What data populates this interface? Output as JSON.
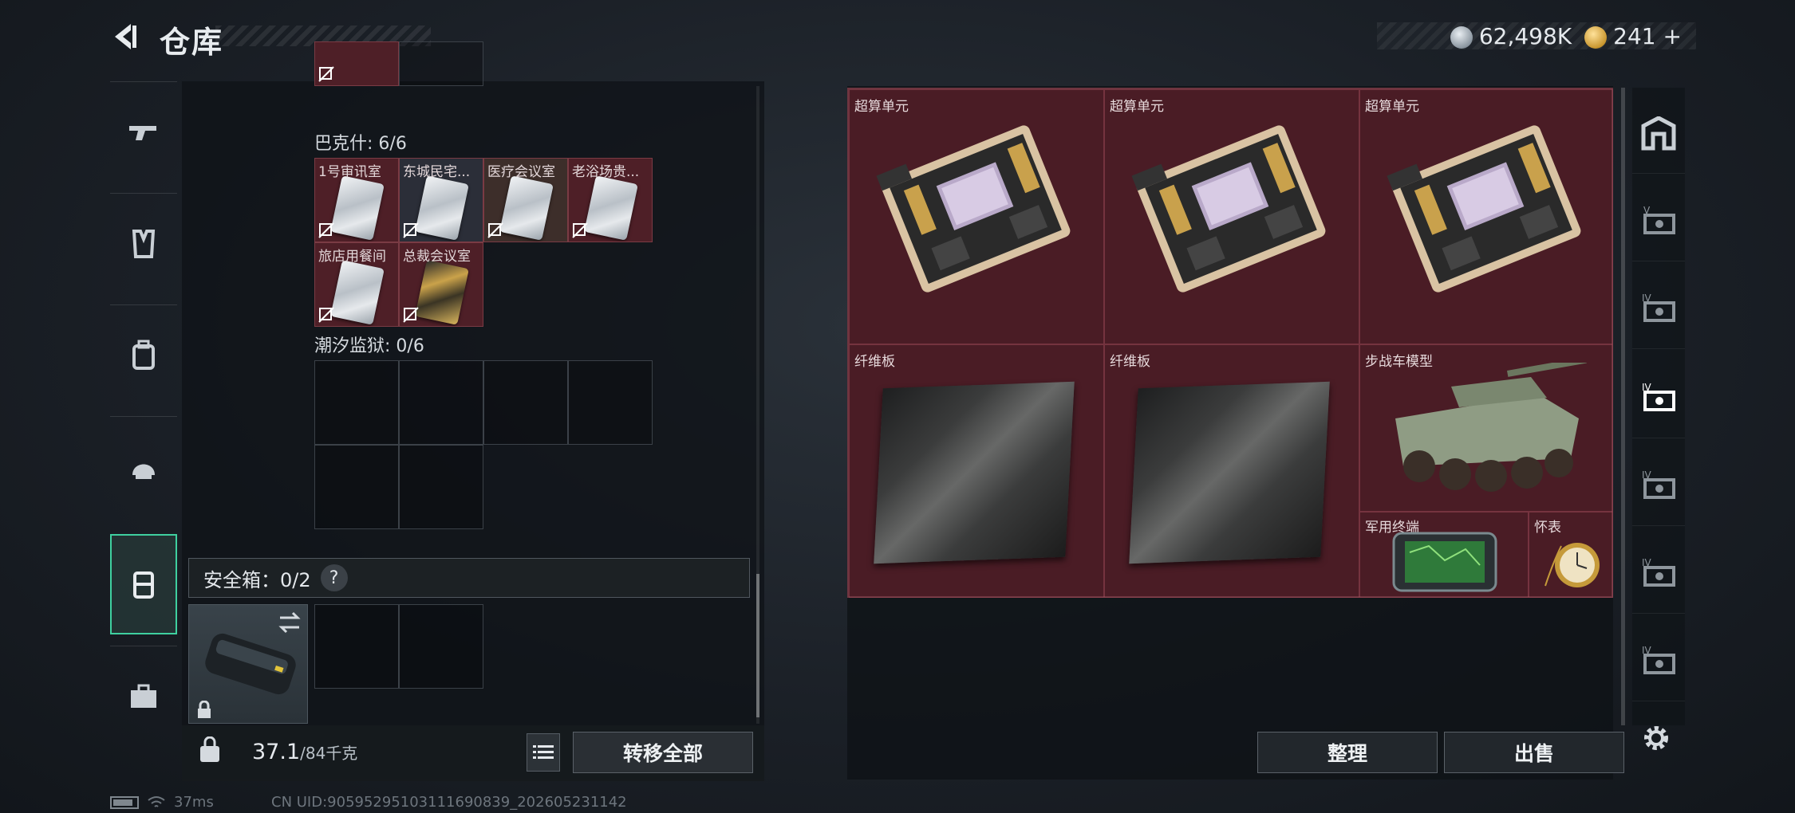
{
  "header": {
    "title": "仓库",
    "currency_silver": "62,498K",
    "currency_gold": "241",
    "add_symbol": "+"
  },
  "left_tabs": [
    {
      "icon": "gun-icon",
      "active": false
    },
    {
      "icon": "armor-vest-icon",
      "active": false
    },
    {
      "icon": "backpack-icon",
      "active": false
    },
    {
      "icon": "helmet-icon",
      "active": false
    },
    {
      "icon": "container-icon",
      "active": true
    },
    {
      "icon": "toolbox-icon",
      "active": false
    }
  ],
  "inventory": {
    "sections": [
      {
        "label": "巴克什: 6/6"
      },
      {
        "label": "潮汐监狱: 0/6"
      }
    ],
    "bakshi_items": [
      {
        "label": "1号审讯室"
      },
      {
        "label": "东城民宅..."
      },
      {
        "label": "医疗会议室"
      },
      {
        "label": "老浴场贵..."
      },
      {
        "label": "旅店用餐间"
      },
      {
        "label": "总裁会议室"
      }
    ],
    "safebox_label": "安全箱：0/2",
    "help_symbol": "?",
    "weight_current": "37.1",
    "weight_max": "/84千克",
    "transfer_all": "转移全部"
  },
  "stash": {
    "items": [
      {
        "label": "超算单元"
      },
      {
        "label": "超算单元"
      },
      {
        "label": "超算单元"
      },
      {
        "label": "纤维板"
      },
      {
        "label": "纤维板"
      },
      {
        "label": "步战车模型"
      },
      {
        "label": "军用终端"
      },
      {
        "label": "怀表"
      }
    ],
    "sort_button": "整理",
    "sell_button": "出售"
  },
  "right_tabs": [
    {
      "label": "",
      "icon": "home-stash-icon"
    },
    {
      "label": "V",
      "icon": "stash-page-icon"
    },
    {
      "label": "IV",
      "icon": "stash-page-icon"
    },
    {
      "label": "IV",
      "icon": "stash-page-icon"
    },
    {
      "label": "IV",
      "icon": "stash-page-icon"
    },
    {
      "label": "IV",
      "icon": "stash-page-icon"
    },
    {
      "label": "IV",
      "icon": "stash-page-icon"
    }
  ],
  "status": {
    "ping": "37ms",
    "uid": "CN UID:9059529510311169083​9_202605231142"
  },
  "colors": {
    "item_bg": "#4e1f27",
    "stash_bg": "#4a1c25",
    "active_accent": "#3fd0a0"
  }
}
